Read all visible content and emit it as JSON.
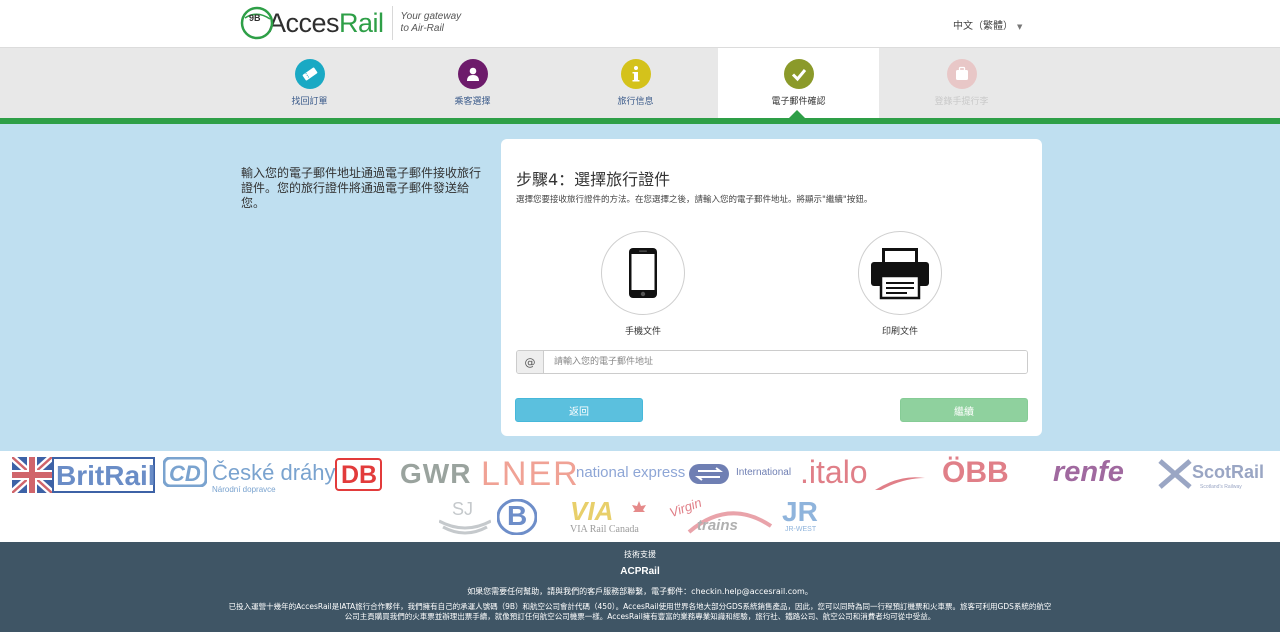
{
  "header": {
    "logo_code": "9B",
    "logo_text_a": "Acces",
    "logo_text_b": "Rail",
    "tagline_line1": "Your gateway",
    "tagline_line2": "to Air-Rail",
    "language": "中文（繁體）"
  },
  "steps": [
    {
      "label": "找回訂單",
      "color": "#1aa9c4",
      "icon": "ticket-icon"
    },
    {
      "label": "乘客選擇",
      "color": "#6d1b6b",
      "icon": "person-icon"
    },
    {
      "label": "旅行信息",
      "color": "#d4c21b",
      "icon": "info-icon"
    },
    {
      "label": "電子郵件確認",
      "color": "#8b9a2a",
      "icon": "check-icon"
    },
    {
      "label": "登錄手提行李",
      "color": "#e8c7c7",
      "icon": "luggage-icon"
    }
  ],
  "side_text": "輸入您的電子郵件地址通過電子郵件接收旅行證件。您的旅行證件將通過電子郵件發送給您。",
  "card": {
    "title": "步驟4：選擇旅行證件",
    "description": "選擇您要接收旅行證件的方法。在您選擇之後，請輸入您的電子郵件地址。將顯示\"繼續\"按鈕。",
    "option_mobile": "手機文件",
    "option_print": "印刷文件",
    "email_addon": "@",
    "email_placeholder": "請輸入您的電子郵件地址",
    "email_value": "",
    "back_label": "返回",
    "next_label": "繼續"
  },
  "rail_logos": {
    "britrail": "BritRail",
    "cd_name": "České dráhy",
    "cd_sub": "Národní dopravce",
    "db": "DB",
    "gwr": "GWR",
    "lner": "LNER",
    "national_express": "national express",
    "ns": "International",
    "italo": ".italo",
    "obb": "ÖBB",
    "renfe": "renfe",
    "scotrail": "ScotRail",
    "scotrail_sub": "Scotland's Railway",
    "sj": "SJ",
    "sncb": "B",
    "via": "VIA",
    "via_sub": "VIA Rail Canada",
    "virgin": "Virgin",
    "virgin_trains": "trains",
    "jr": "JR",
    "jr_sub": "JR-WEST"
  },
  "footer": {
    "support": "技術支援",
    "logo": "ACPRail",
    "help": "如果您需要任何幫助，請與我們的客戶服務部聯繫，電子郵件：checkin.help@accesrail.com。",
    "about": "已投入運營十幾年的AccesRail是IATA旅行合作夥伴，我們擁有自己的承運人號碼（9B）和航空公司會計代碼（450）。AccesRail使用世界各地大部分GDS系統銷售產品，因此，您可以同時為同一行程預訂機票和火車票。旅客可利用GDS系統的航空公司主頁購買我們的火車票並辦理出票手續，就像預訂任何航空公司機票一樣。AccesRail擁有豐富的業務專業知識和經驗，旅行社、鐵路公司、航空公司和消費者均可從中受益。"
  }
}
